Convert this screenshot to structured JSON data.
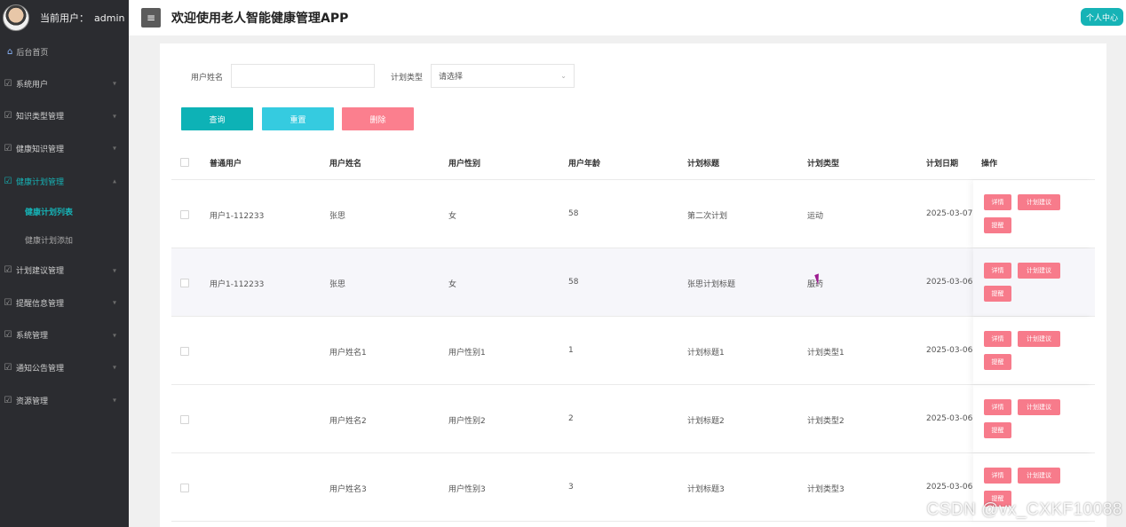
{
  "sidebar": {
    "user_label": "当前用户：",
    "username": "admin",
    "home": "后台首页",
    "items": [
      {
        "label": "系统用户"
      },
      {
        "label": "知识类型管理"
      },
      {
        "label": "健康知识管理"
      },
      {
        "label": "健康计划管理",
        "active": true
      },
      {
        "label": "计划建议管理"
      },
      {
        "label": "提醒信息管理"
      },
      {
        "label": "系统管理"
      },
      {
        "label": "通知公告管理"
      },
      {
        "label": "资源管理"
      }
    ],
    "subitems": [
      {
        "label": "健康计划列表",
        "active": true
      },
      {
        "label": "健康计划添加"
      }
    ]
  },
  "header": {
    "title": "欢迎使用老人智能健康管理APP",
    "personal_center": "个人中心"
  },
  "filters": {
    "username_label": "用户姓名",
    "username_value": "",
    "plan_type_label": "计划类型",
    "plan_type_value": "请选择"
  },
  "buttons": {
    "query": "查询",
    "reset": "重置",
    "delete": "删除"
  },
  "table": {
    "columns": [
      "普通用户",
      "用户姓名",
      "用户性别",
      "用户年龄",
      "计划标题",
      "计划类型",
      "计划日期",
      "操作"
    ],
    "rows": [
      [
        "用户1-112233",
        "张思",
        "女",
        "58",
        "第二次计划",
        "运动",
        "2025-03-07"
      ],
      [
        "用户1-112233",
        "张思",
        "女",
        "58",
        "张思计划标题",
        "服药",
        "2025-03-06"
      ],
      [
        "",
        "用户姓名1",
        "用户性别1",
        "1",
        "计划标题1",
        "计划类型1",
        "2025-03-06"
      ],
      [
        "",
        "用户姓名2",
        "用户性别2",
        "2",
        "计划标题2",
        "计划类型2",
        "2025-03-06"
      ],
      [
        "",
        "用户姓名3",
        "用户性别3",
        "3",
        "计划标题3",
        "计划类型3",
        "2025-03-06"
      ]
    ],
    "actions": {
      "detail": "详情",
      "advice": "计划建议",
      "remind": "提醒"
    }
  },
  "watermark": "CSDN @vx_CXKF10088",
  "colors": {
    "sidebar_bg": "#2b2c30",
    "accent": "#16b3b6",
    "danger": "#f77b8b"
  }
}
